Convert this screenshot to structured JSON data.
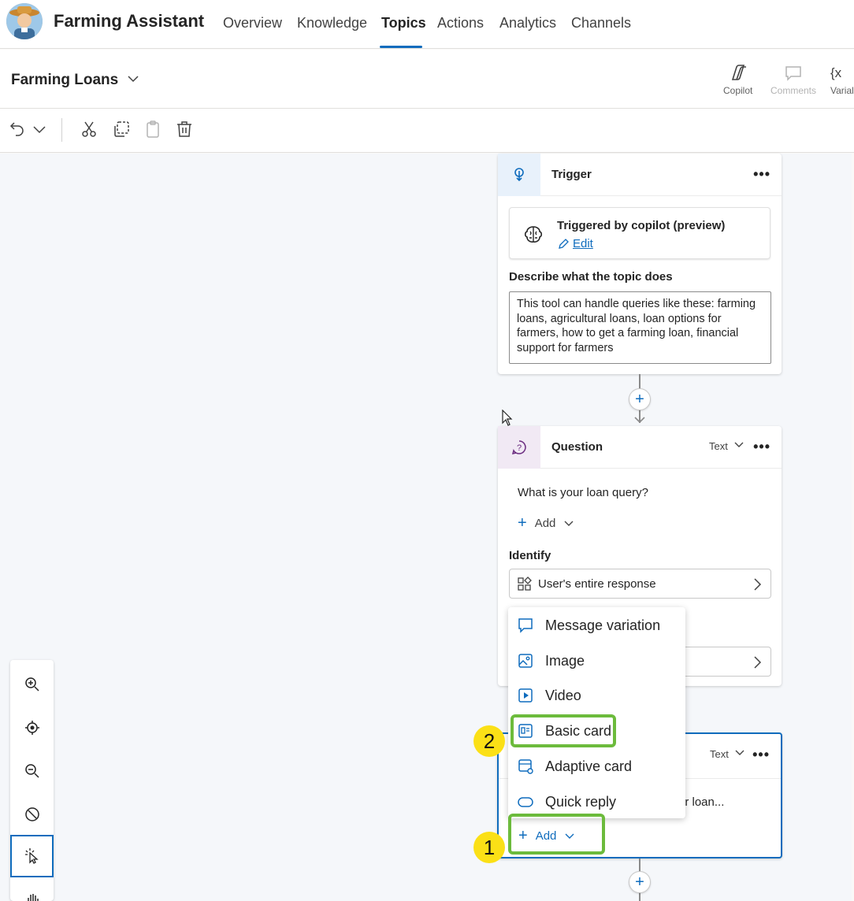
{
  "app": {
    "title": "Farming Assistant"
  },
  "nav": {
    "tabs": [
      "Overview",
      "Knowledge",
      "Topics",
      "Actions",
      "Analytics",
      "Channels"
    ],
    "active": "Topics"
  },
  "topic": {
    "name": "Farming Loans"
  },
  "toolbar": {
    "copilot": "Copilot",
    "comments": "Comments",
    "variables": "Varial"
  },
  "trigger": {
    "title": "Trigger",
    "card_title": "Triggered by copilot (preview)",
    "edit_label": "Edit",
    "desc_label": "Describe what the topic does",
    "description": "This tool can handle queries like these: farming loans, agricultural loans, loan options for farmers, how to get a farming loan, financial support for farmers"
  },
  "question": {
    "title": "Question",
    "type": "Text",
    "prompt": "What is your loan query?",
    "add_label": "Add",
    "identify_label": "Identify",
    "identify_value": "User's entire response"
  },
  "node3": {
    "type": "Text",
    "partial_text": "ur loan...",
    "add_label": "Add"
  },
  "menu": {
    "items": [
      "Message variation",
      "Image",
      "Video",
      "Basic card",
      "Adaptive card",
      "Quick reply"
    ]
  },
  "badges": {
    "step1": "1",
    "step2": "2"
  },
  "colors": {
    "accent": "#0f6cbd",
    "highlight": "#6cbb3c",
    "badge": "#fbe016"
  }
}
